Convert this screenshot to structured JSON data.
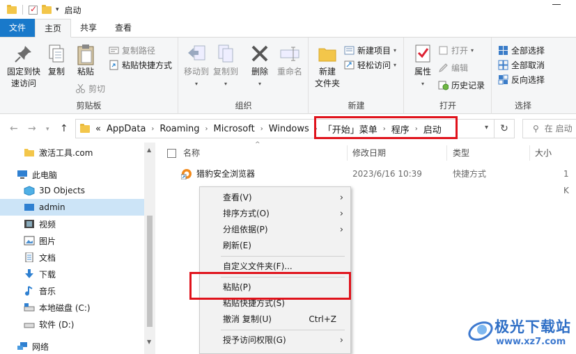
{
  "window": {
    "title": "启动"
  },
  "tabs": {
    "file": "文件",
    "home": "主页",
    "share": "共享",
    "view": "查看"
  },
  "ribbon": {
    "clipboard": {
      "label": "剪贴板",
      "pin": "固定到快\n速访问",
      "copy": "复制",
      "paste": "粘贴",
      "copy_path": "复制路径",
      "paste_shortcut": "粘贴快捷方式",
      "cut": "剪切"
    },
    "organize": {
      "label": "组织",
      "move_to": "移动到",
      "copy_to": "复制到",
      "delete": "删除",
      "rename": "重命名"
    },
    "new": {
      "label": "新建",
      "new_folder": "新建\n文件夹",
      "new_item": "新建项目",
      "easy_access": "轻松访问"
    },
    "open": {
      "label": "打开",
      "properties": "属性",
      "open": "打开",
      "edit": "编辑",
      "history": "历史记录"
    },
    "select": {
      "label": "选择",
      "select_all": "全部选择",
      "select_none": "全部取消",
      "invert": "反向选择"
    }
  },
  "address": {
    "prefix": "«",
    "crumbs": [
      "AppData",
      "Roaming",
      "Microsoft",
      "Windows",
      "「开始」菜单",
      "程序",
      "启动"
    ],
    "search_placeholder": "在 启动"
  },
  "nav_pane": {
    "items": [
      {
        "label": "激活工具.com",
        "icon": "folder-icon"
      },
      {
        "label": "此电脑",
        "icon": "computer-icon"
      },
      {
        "label": "3D Objects",
        "icon": "3d-objects-icon"
      },
      {
        "label": "admin",
        "icon": "desktop-icon",
        "selected": true
      },
      {
        "label": "视频",
        "icon": "video-icon"
      },
      {
        "label": "图片",
        "icon": "pictures-icon"
      },
      {
        "label": "文档",
        "icon": "documents-icon"
      },
      {
        "label": "下载",
        "icon": "download-icon"
      },
      {
        "label": "音乐",
        "icon": "music-icon"
      },
      {
        "label": "本地磁盘 (C:)",
        "icon": "drive-icon"
      },
      {
        "label": "软件 (D:)",
        "icon": "drive-icon"
      },
      {
        "label": "网络",
        "icon": "network-icon"
      }
    ]
  },
  "file_list": {
    "columns": {
      "name": "名称",
      "date": "修改日期",
      "type": "类型",
      "size": "大小"
    },
    "rows": [
      {
        "name": "猎豹安全浏览器",
        "date": "2023/6/16 10:39",
        "type": "快捷方式",
        "size": "1 K"
      }
    ]
  },
  "context_menu": {
    "items": [
      {
        "label": "查看(V)",
        "submenu": true
      },
      {
        "label": "排序方式(O)",
        "submenu": true
      },
      {
        "label": "分组依据(P)",
        "submenu": true
      },
      {
        "label": "刷新(E)"
      },
      {
        "label": "自定义文件夹(F)..."
      },
      {
        "label": "粘贴(P)"
      },
      {
        "label": "粘贴快捷方式(S)"
      },
      {
        "label": "撤消 复制(U)",
        "shortcut": "Ctrl+Z"
      },
      {
        "label": "授予访问权限(G)",
        "submenu": true
      }
    ]
  },
  "watermark": {
    "title": "极光下载站",
    "url": "www.xz7.com"
  },
  "colors": {
    "accent": "#1979ca",
    "highlight_box": "#e0121b",
    "selected_nav": "#cce4f7"
  }
}
